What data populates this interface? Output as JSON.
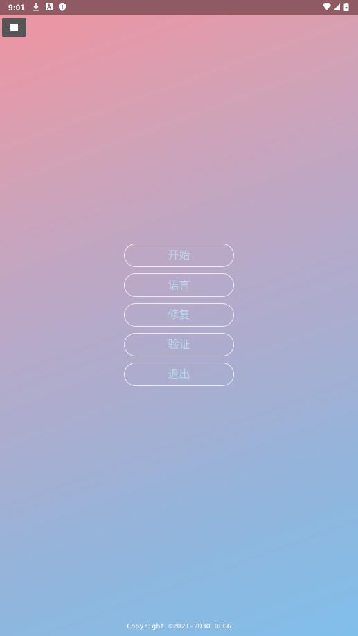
{
  "status_bar": {
    "time": "9:01",
    "icons_left": [
      "download-icon",
      "a-notification-icon",
      "shield-icon"
    ],
    "icons_right": [
      "wifi-icon",
      "signal-icon",
      "battery-icon"
    ],
    "background": "#8f5a62"
  },
  "overlay": {
    "stop_icon": "stop-icon"
  },
  "menu": {
    "buttons": [
      {
        "label": "开始"
      },
      {
        "label": "语言"
      },
      {
        "label": "修复"
      },
      {
        "label": "验证"
      },
      {
        "label": "退出"
      }
    ],
    "text_color": "#b8d9ea",
    "border_color": "#f2eaf2"
  },
  "footer": {
    "copyright": "Copyright ©2021-2030 RLGG"
  },
  "colors": {
    "gradient_start": "#f2929f",
    "gradient_end": "#80bfea"
  }
}
